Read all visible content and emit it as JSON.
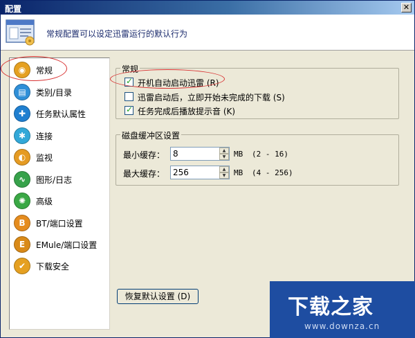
{
  "window": {
    "title": "配置",
    "close_glyph": "✕"
  },
  "header": {
    "icon": "settings-window-icon",
    "text": "常规配置可以设定迅雷运行的默认行为"
  },
  "sidebar": {
    "items": [
      {
        "label": "常规",
        "icon": "user-icon",
        "color": "#e5a021",
        "glyph": "◉"
      },
      {
        "label": "类别/目录",
        "icon": "folder-icon",
        "color": "#2f8fd8",
        "glyph": "▤"
      },
      {
        "label": "任务默认属性",
        "icon": "task-properties-icon",
        "color": "#1f7fd0",
        "glyph": "✚"
      },
      {
        "label": "连接",
        "icon": "connection-icon",
        "color": "#32a8d8",
        "glyph": "✱"
      },
      {
        "label": "监视",
        "icon": "monitor-icon",
        "color": "#e59b23",
        "glyph": "◐"
      },
      {
        "label": "图形/日志",
        "icon": "graph-log-icon",
        "color": "#37a24b",
        "glyph": "∿"
      },
      {
        "label": "高级",
        "icon": "advanced-icon",
        "color": "#3aa845",
        "glyph": "✺"
      },
      {
        "label": "BT/端口设置",
        "icon": "bt-port-icon",
        "color": "#e58c1e",
        "glyph": "B"
      },
      {
        "label": "EMule/端口设置",
        "icon": "emule-port-icon",
        "color": "#d98a18",
        "glyph": "E"
      },
      {
        "label": "下载安全",
        "icon": "security-icon",
        "color": "#e5a021",
        "glyph": "✔"
      }
    ]
  },
  "general": {
    "title": "常规",
    "options": [
      {
        "label": "开机自动启动迅雷 (R)",
        "checked": true
      },
      {
        "label": "迅雷启动后，立即开始未完成的下载 (S)",
        "checked": false
      },
      {
        "label": "任务完成后播放提示音 (K)",
        "checked": true
      }
    ],
    "check_glyph": "✓"
  },
  "disk_cache": {
    "title": "磁盘缓冲区设置",
    "min_label": "最小缓存：",
    "min_value": "8",
    "min_unit": "MB",
    "min_range": "(2 - 16)",
    "max_label": "最大缓存：",
    "max_value": "256",
    "max_unit": "MB",
    "max_range": "(4 - 256)"
  },
  "buttons": {
    "restore_defaults": "恢复默认设置 (D)"
  },
  "watermark": {
    "logo": "下载之家",
    "url": "www.downza.cn"
  },
  "colors": {
    "title_bar": "#0a246a",
    "annotation": "#d83030",
    "watermark_bg": "#1e4da1",
    "check": "#21a121"
  }
}
